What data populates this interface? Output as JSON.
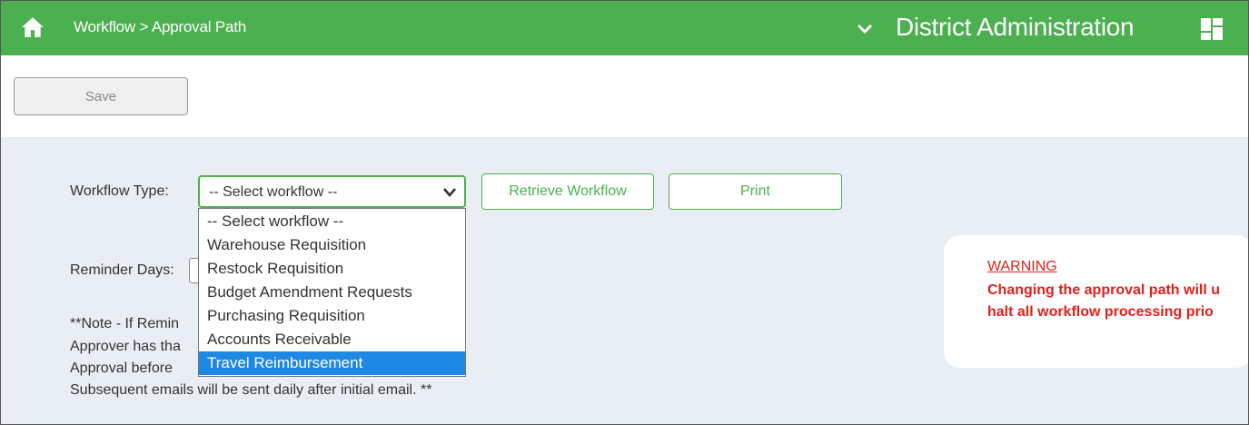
{
  "header": {
    "breadcrumb": "Workflow > Approval Path",
    "context_title": "District Administration",
    "icons": [
      "home-icon",
      "chevron-down-icon",
      "grid-icon"
    ],
    "bar_color": "#4caf50"
  },
  "toolbar": {
    "save_label": "Save"
  },
  "form": {
    "workflow_type_label": "Workflow Type:",
    "workflow_select_value": "-- Select workflow --",
    "retrieve_label": "Retrieve Workflow",
    "print_label": "Print",
    "reminder_label": "Reminder Days:",
    "reminder_value": "",
    "note_lines": [
      "**Note - If Remin",
      "Approver has tha",
      "Approval before",
      "Subsequent emails will be sent daily after initial email. **"
    ]
  },
  "dropdown": {
    "options": [
      "-- Select workflow --",
      "Warehouse Requisition",
      "Restock Requisition",
      "Budget Amendment Requests",
      "Purchasing Requisition",
      "Accounts Receivable",
      "Travel Reimbursement"
    ],
    "highlighted": "Travel Reimbursement",
    "highlight_color": "#1e88e5"
  },
  "warning": {
    "title": "WARNING",
    "lines": [
      "Changing the approval path will u",
      "halt all workflow processing prio"
    ],
    "color": "#e0201b"
  }
}
